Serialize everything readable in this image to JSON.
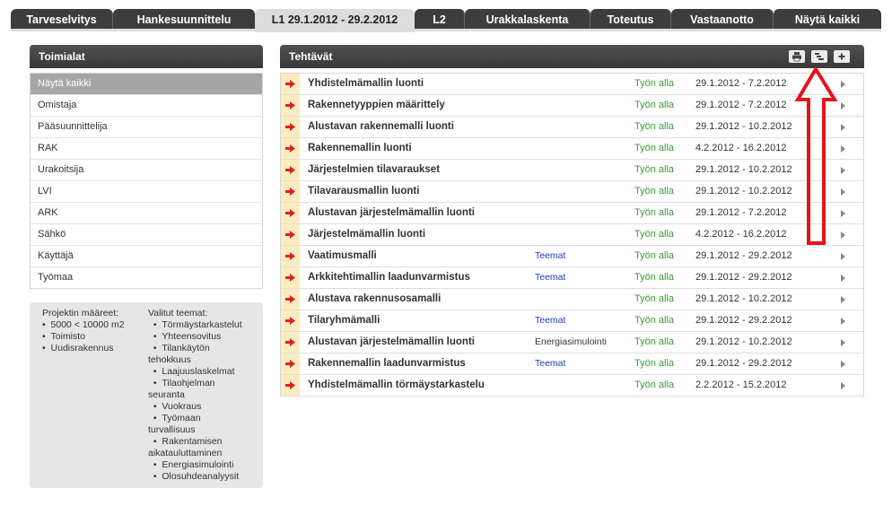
{
  "tabs": [
    {
      "label": "Tarveselvitys",
      "active": false
    },
    {
      "label": "Hankesuunnittelu",
      "active": false
    },
    {
      "label": "L1 29.1.2012 - 29.2.2012",
      "active": true
    },
    {
      "label": "L2",
      "active": false
    },
    {
      "label": "Urakkalaskenta",
      "active": false
    },
    {
      "label": "Toteutus",
      "active": false
    },
    {
      "label": "Vastaanotto",
      "active": false
    },
    {
      "label": "Näytä kaikki",
      "active": false
    }
  ],
  "industries": {
    "title": "Toimialat",
    "items": [
      "Näytä kaikki",
      "Omistaja",
      "Pääsuunnittelija",
      "RAK",
      "Urakoitsija",
      "LVI",
      "ARK",
      "Sähkö",
      "Käyttäjä",
      "Työmaa"
    ],
    "selected_index": 0
  },
  "project_info": {
    "params_title": "Projektin määreet:",
    "params": [
      "5000 < 10000 m2",
      "Toimisto",
      "Uudisrakennus"
    ],
    "themes_title": "Valitut teemat:",
    "themes_lines": [
      {
        "text": "Törmäystarkastelut",
        "bullet": true
      },
      {
        "text": "Yhteensovitus",
        "bullet": true
      },
      {
        "text": "Tilankäytön",
        "bullet": true
      },
      {
        "text": "tehokkuus",
        "bullet": false
      },
      {
        "text": "Laajuuslaskelmat",
        "bullet": true
      },
      {
        "text": "Tilaohjelman",
        "bullet": true
      },
      {
        "text": "seuranta",
        "bullet": false
      },
      {
        "text": "Vuokraus",
        "bullet": true
      },
      {
        "text": "Työmaan",
        "bullet": true
      },
      {
        "text": "turvallisuus",
        "bullet": false
      },
      {
        "text": "Rakentamisen",
        "bullet": true
      },
      {
        "text": "aikatauluttaminen",
        "bullet": false
      },
      {
        "text": "Energiasimulointi",
        "bullet": true
      },
      {
        "text": "Olosuhdeanalyysit",
        "bullet": true
      }
    ]
  },
  "tasks": {
    "title": "Tehtävät",
    "rows": [
      {
        "name": "Yhdistelmämallin luonti",
        "theme": "",
        "status": "Työn alla",
        "dates": "29.1.2012 - 7.2.2012"
      },
      {
        "name": "Rakennetyyppien määrittely",
        "theme": "",
        "status": "Työn alla",
        "dates": "29.1.2012 - 7.2.2012"
      },
      {
        "name": "Alustavan rakennemalli luonti",
        "theme": "",
        "status": "Työn alla",
        "dates": "29.1.2012 - 10.2.2012"
      },
      {
        "name": "Rakennemallin luonti",
        "theme": "",
        "status": "Työn alla",
        "dates": "4.2.2012 - 16.2.2012"
      },
      {
        "name": "Järjestelmien tilavaraukset",
        "theme": "",
        "status": "Työn alla",
        "dates": "29.1.2012 - 10.2.2012"
      },
      {
        "name": "Tilavarausmallin luonti",
        "theme": "",
        "status": "Työn alla",
        "dates": "29.1.2012 - 10.2.2012"
      },
      {
        "name": "Alustavan järjestelmämallin luonti",
        "theme": "",
        "status": "Työn alla",
        "dates": "29.1.2012 - 7.2.2012"
      },
      {
        "name": "Järjestelmämallin luonti",
        "theme": "",
        "status": "Työn alla",
        "dates": "4.2.2012 - 16.2.2012"
      },
      {
        "name": "Vaatimusmalli",
        "theme": "Teemat",
        "status": "Työn alla",
        "dates": "29.1.2012 - 29.2.2012"
      },
      {
        "name": "Arkkitehtimallin laadunvarmistus",
        "theme": "Teemat",
        "status": "Työn alla",
        "dates": "29.1.2012 - 29.2.2012"
      },
      {
        "name": "Alustava rakennusosamalli",
        "theme": "",
        "status": "Työn alla",
        "dates": "29.1.2012 - 10.2.2012"
      },
      {
        "name": "Tilaryhmämalli",
        "theme": "Teemat",
        "status": "Työn alla",
        "dates": "29.1.2012 - 29.2.2012"
      },
      {
        "name": "Alustavan järjestelmämallin luonti",
        "theme": "Energiasimulointi",
        "status": "Työn alla",
        "dates": "29.1.2012 - 10.2.2012"
      },
      {
        "name": "Rakennemallin laadunvarmistus",
        "theme": "Teemat",
        "status": "Työn alla",
        "dates": "29.1.2012 - 29.2.2012"
      },
      {
        "name": "Yhdistelmämallin törmäystarkastelu",
        "theme": "",
        "status": "Työn alla",
        "dates": "2.2.2012 - 15.2.2012"
      }
    ]
  },
  "colors": {
    "status": "#3a9b3a",
    "theme_link": "#1a3fb5",
    "row_marker": "#fbecc0",
    "arrow_icon": "#e02020",
    "annotation": "#e8141a"
  }
}
